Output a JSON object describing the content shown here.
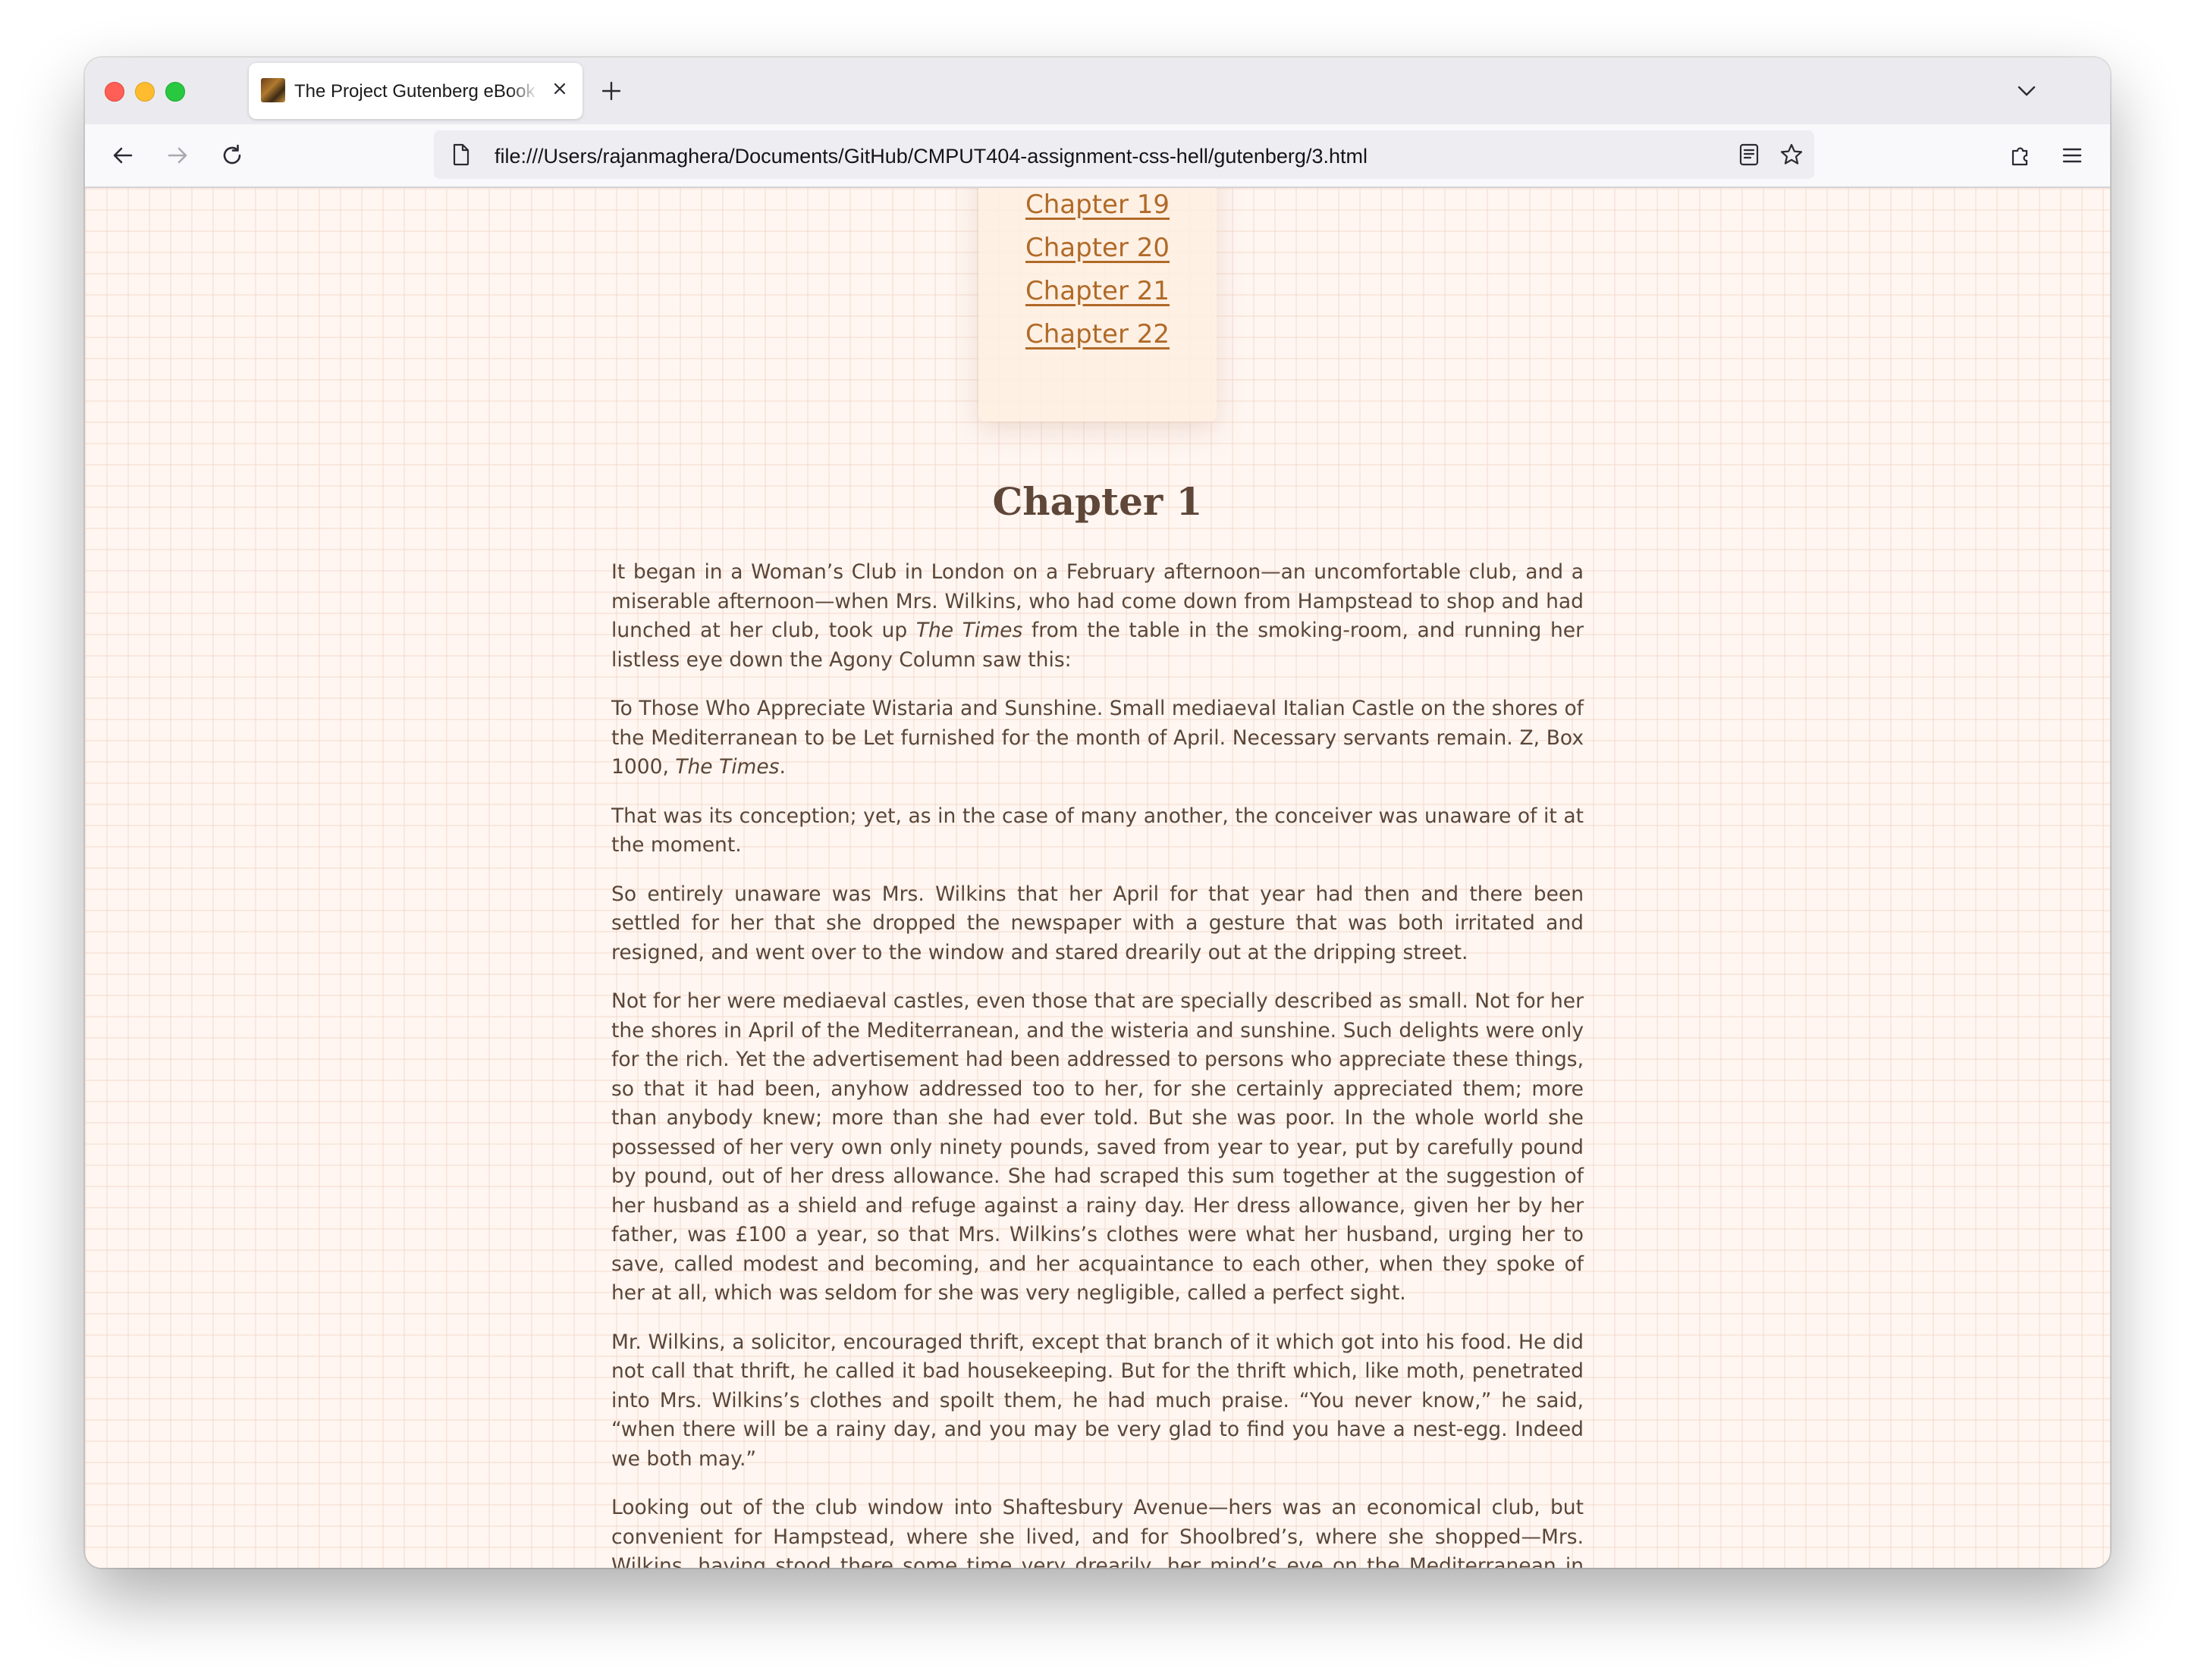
{
  "browser": {
    "tab": {
      "title": "The Project Gutenberg eBook of The Enchanted April, by Elizabeth von Arnim",
      "favicon": "book-cover-thumbnail",
      "close_icon": "close-icon"
    },
    "new_tab_icon": "plus-icon",
    "tab_list_icon": "chevron-down-icon",
    "nav": {
      "back_icon": "arrow-left-icon",
      "forward_icon": "arrow-right-icon",
      "reload_icon": "reload-icon"
    },
    "address_bar": {
      "url": "file:///Users/rajanmaghera/Documents/GitHub/CMPUT404-assignment-css-hell/gutenberg/3.html",
      "page_icon": "page-icon",
      "reader_icon": "reader-view-icon",
      "bookmark_icon": "star-icon"
    },
    "extensions_icon": "puzzle-icon",
    "menu_icon": "hamburger-menu-icon"
  },
  "colors": {
    "link": "#b06a28",
    "heading": "#5e4638",
    "body_text": "#5a4638",
    "page_background": "#fff6f1",
    "toc_background": "#ffeee2"
  },
  "toc": {
    "links": [
      "Chapter 19",
      "Chapter 20",
      "Chapter 21",
      "Chapter 22"
    ]
  },
  "chapter": {
    "title": "Chapter 1",
    "paragraphs": [
      [
        {
          "t": "It began in a Woman’s Club in London on a February afternoon—an uncomfortable club, and a miserable afternoon—when Mrs. Wilkins, who had come down from Hampstead to shop and had lunched at her club, took up "
        },
        {
          "t": "The Times",
          "i": true
        },
        {
          "t": " from the table in the smoking-room, and running her listless eye down the Agony Column saw this:"
        }
      ],
      [
        {
          "t": "To Those Who Appreciate Wistaria and Sunshine. Small mediaeval Italian Castle on the shores of the Mediterranean to be Let furnished for the month of April. Necessary servants remain. Z, Box 1000, "
        },
        {
          "t": "The Times",
          "i": true
        },
        {
          "t": "."
        }
      ],
      [
        {
          "t": "That was its conception; yet, as in the case of many another, the conceiver was unaware of it at the moment."
        }
      ],
      [
        {
          "t": "So entirely unaware was Mrs. Wilkins that her April for that year had then and there been settled for her that she dropped the newspaper with a gesture that was both irritated and resigned, and went over to the window and stared drearily out at the dripping street."
        }
      ],
      [
        {
          "t": "Not for her were mediaeval castles, even those that are specially described as small. Not for her the shores in April of the Mediterranean, and the wisteria and sunshine. Such delights were only for the rich. Yet the advertisement had been addressed to persons who appreciate these things, so that it had been, anyhow addressed too to her, for she certainly appreciated them; more than anybody knew; more than she had ever told. But she was poor. In the whole world she possessed of her very own only ninety pounds, saved from year to year, put by carefully pound by pound, out of her dress allowance. She had scraped this sum together at the suggestion of her husband as a shield and refuge against a rainy day. Her dress allowance, given her by her father, was £100 a year, so that Mrs. Wilkins’s clothes were what her husband, urging her to save, called modest and becoming, and her acquaintance to each other, when they spoke of her at all, which was seldom for she was very negligible, called a perfect sight."
        }
      ],
      [
        {
          "t": "Mr. Wilkins, a solicitor, encouraged thrift, except that branch of it which got into his food. He did not call that thrift, he called it bad housekeeping. But for the thrift which, like moth, penetrated into Mrs. Wilkins’s clothes and spoilt them, he had much praise. “You never know,” he said, “when there will be a rainy day, and you may be very glad to find you have a nest-egg. Indeed we both may.”"
        }
      ],
      [
        {
          "t": "Looking out of the club window into Shaftesbury Avenue—hers was an economical club, but convenient for Hampstead, where she lived, and for Shoolbred’s, where she shopped—Mrs. Wilkins, having stood there some time very drearily, her mind’s eye on the Mediterranean in April, and the wisteria, and the enviable opportunities of the rich, while her bodily eye watched the really extremely horrible sooty rain falling steadily on the hurrying umbrellas and splashing omnibuses, suddenly wondered whether perhaps this was not the rainy day Mellersh—Mellersh was Mr. Wilkins—had so"
        }
      ]
    ]
  }
}
